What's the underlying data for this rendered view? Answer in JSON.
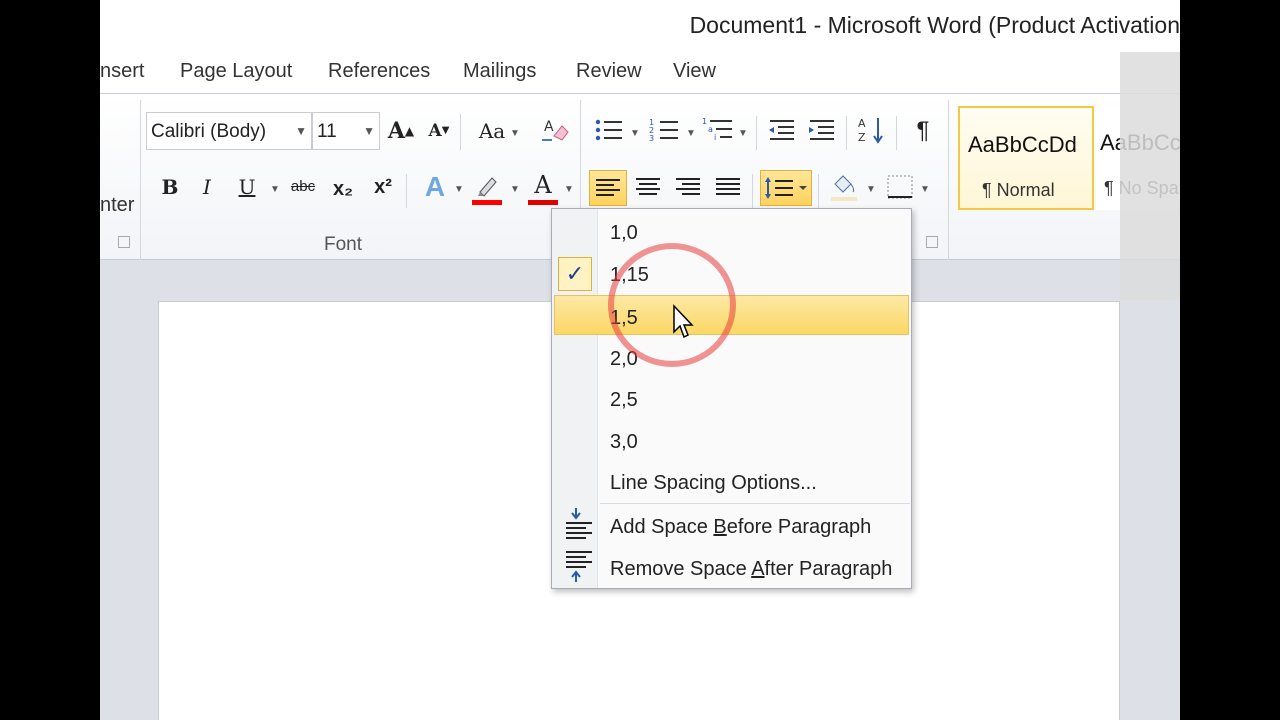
{
  "window": {
    "title": "Document1  -  Microsoft Word (Product Activation"
  },
  "tabs": [
    "nsert",
    "Page Layout",
    "References",
    "Mailings",
    "Review",
    "View"
  ],
  "clipboard": {
    "partial_label": "nter"
  },
  "font_group": {
    "label": "Font",
    "font_name": "Calibri (Body)",
    "font_size": "11",
    "grow_icon": "A",
    "shrink_icon": "A",
    "case_icon": "Aa",
    "bold": "B",
    "italic": "I",
    "underline": "U",
    "strikethrough": "abc",
    "subscript": "x₂",
    "superscript": "x²",
    "text_effects": "A",
    "font_color": "A",
    "highlight_color": "#ff0000",
    "font_color_value": "#e00000"
  },
  "paragraph_group": {
    "show_marks": "¶",
    "active_align": "align-left",
    "line_spacing_active": true
  },
  "styles": [
    {
      "sample": "AaBbCcDd",
      "name": "¶ Normal",
      "selected": true
    },
    {
      "sample": "AaBbCc",
      "name": "¶ No Spa",
      "selected": false
    }
  ],
  "line_spacing_menu": {
    "items": [
      "1,0",
      "1,15",
      "1,5",
      "2,0",
      "2,5",
      "3,0",
      "Line Spacing Options..."
    ],
    "checked": "1,15",
    "hovered": "1,5",
    "add_space_before": {
      "pre": "Add Space ",
      "key": "B",
      "post": "efore Paragraph"
    },
    "remove_space_after": {
      "pre": "Remove Space ",
      "key": "A",
      "post": "fter Paragraph"
    }
  }
}
